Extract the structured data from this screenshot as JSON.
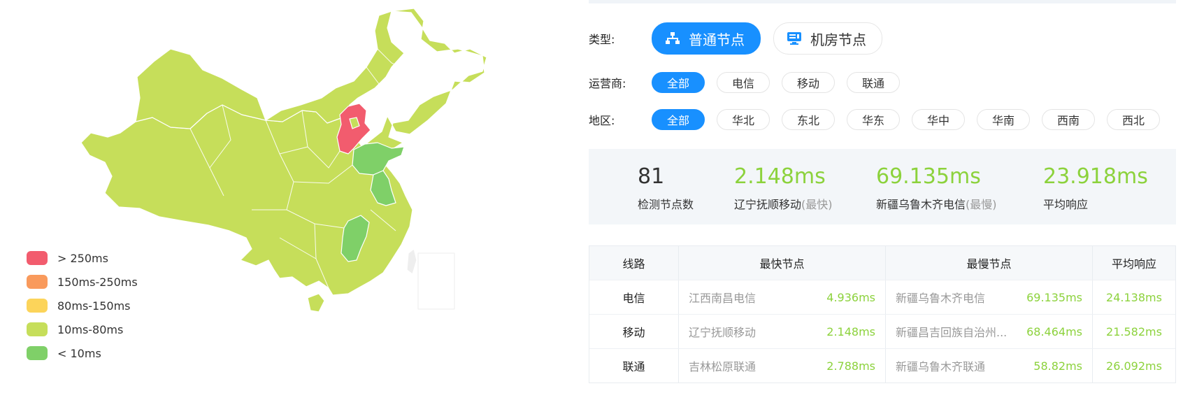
{
  "legend": [
    {
      "label": "> 250ms",
      "color": "#f25c6e"
    },
    {
      "label": "150ms-250ms",
      "color": "#f99a5c"
    },
    {
      "label": "80ms-150ms",
      "color": "#fcd45a"
    },
    {
      "label": "10ms-80ms",
      "color": "#c6de5a"
    },
    {
      "label": "< 10ms",
      "color": "#7fd068"
    }
  ],
  "map_colors": {
    "base": "#c6de5a",
    "red": "#f25c6e",
    "green": "#7fd068",
    "disabled": "#eeeeee"
  },
  "filters": {
    "type_label": "类型:",
    "type_options": [
      {
        "label": "普通节点",
        "icon": "network-nodes-icon",
        "active": true
      },
      {
        "label": "机房节点",
        "icon": "server-monitor-icon",
        "active": false
      }
    ],
    "isp_label": "运营商:",
    "isp_options": [
      "全部",
      "电信",
      "移动",
      "联通"
    ],
    "region_label": "地区:",
    "region_options": [
      "全部",
      "华北",
      "东北",
      "华东",
      "华中",
      "华南",
      "西南",
      "西北"
    ]
  },
  "stats": {
    "count": {
      "value": "81",
      "label": "检测节点数"
    },
    "fastest": {
      "value": "2.148ms",
      "label": "辽宁抚顺移动",
      "sub": "(最快)"
    },
    "slowest": {
      "value": "69.135ms",
      "label": "新疆乌鲁木齐电信",
      "sub": "(最慢)"
    },
    "average": {
      "value": "23.918ms",
      "label": "平均响应"
    }
  },
  "table": {
    "headers": [
      "线路",
      "最快节点",
      "最慢节点",
      "平均响应"
    ],
    "rows": [
      {
        "line": "电信",
        "fast_name": "江西南昌电信",
        "fast_val": "4.936ms",
        "slow_name": "新疆乌鲁木齐电信",
        "slow_val": "69.135ms",
        "avg": "24.138ms"
      },
      {
        "line": "移动",
        "fast_name": "辽宁抚顺移动",
        "fast_val": "2.148ms",
        "slow_name": "新疆昌吉回族自治州...",
        "slow_val": "68.464ms",
        "avg": "21.582ms"
      },
      {
        "line": "联通",
        "fast_name": "吉林松原联通",
        "fast_val": "2.788ms",
        "slow_name": "新疆乌鲁木齐联通",
        "slow_val": "58.82ms",
        "avg": "26.092ms"
      }
    ]
  }
}
